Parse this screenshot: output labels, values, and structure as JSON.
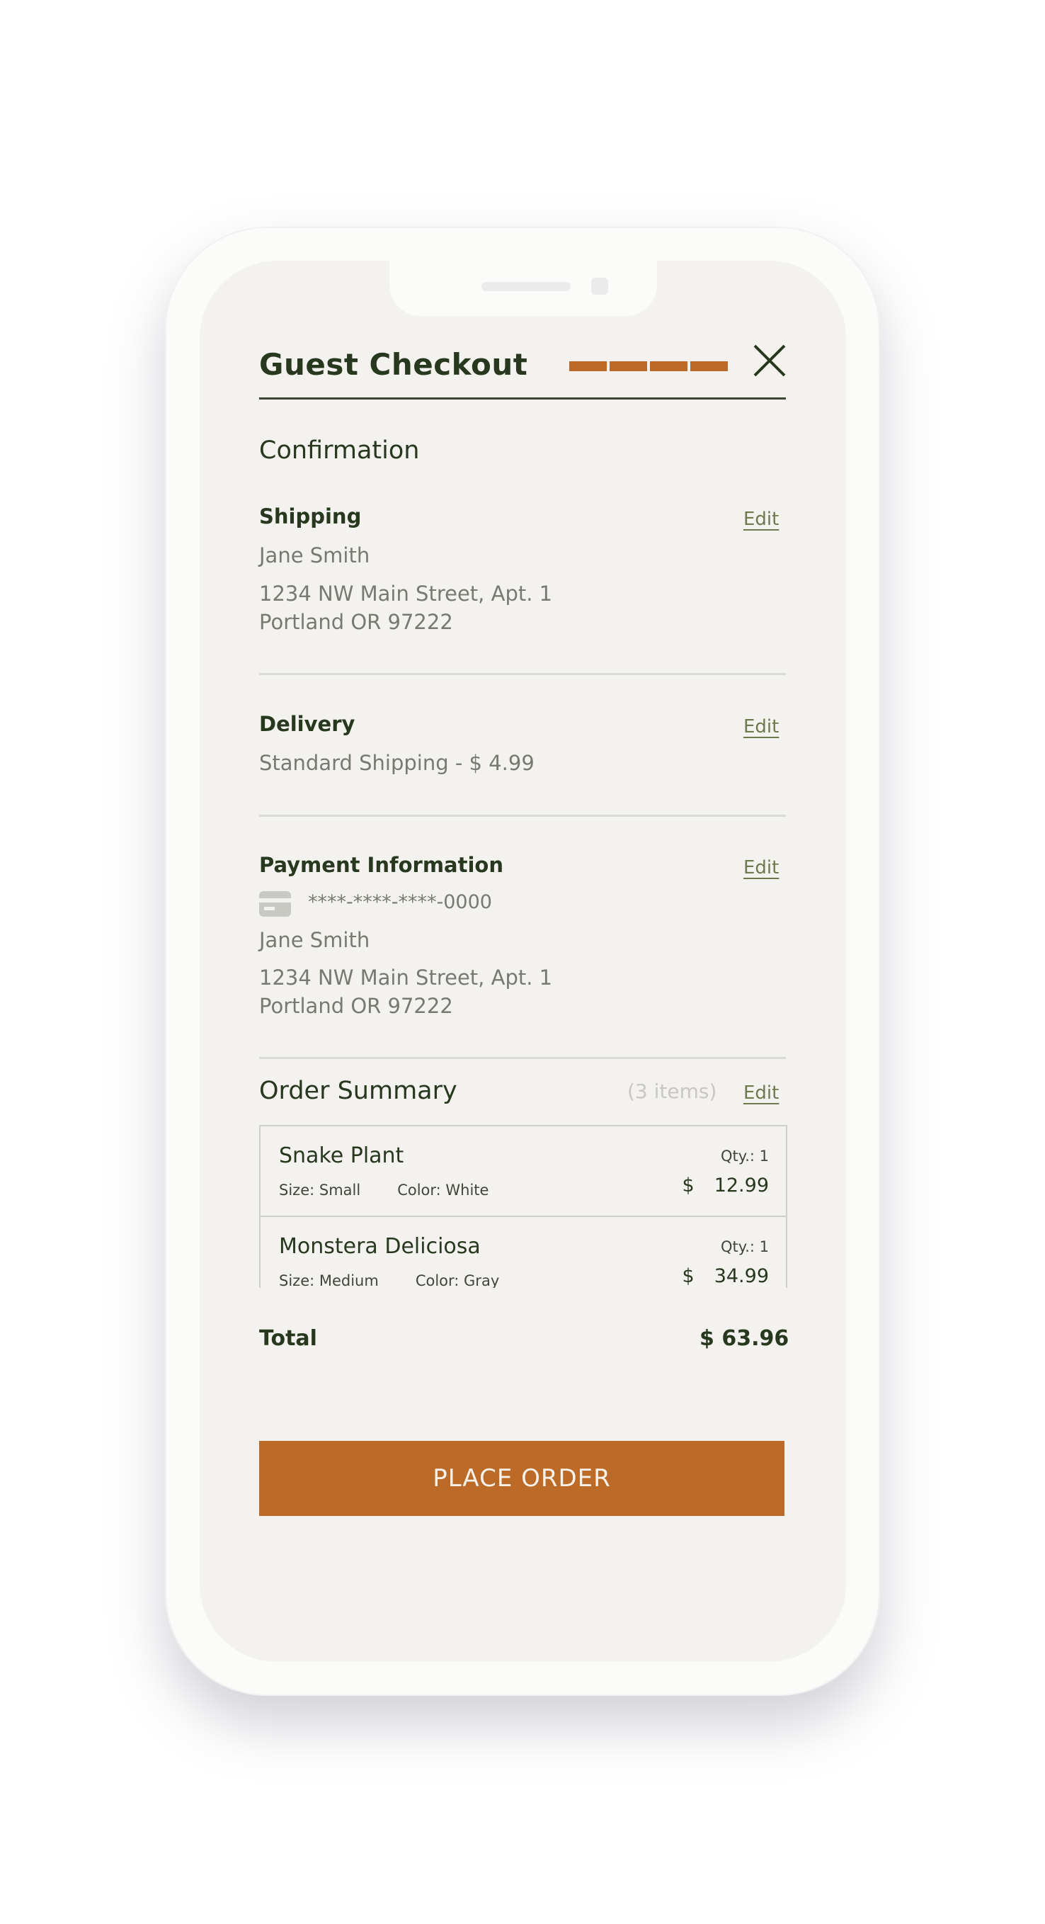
{
  "header": {
    "title": "Guest Checkout",
    "progress_steps": 4,
    "close_icon": "close-icon"
  },
  "step_title": "Confirmation",
  "shipping": {
    "heading": "Shipping",
    "edit_label": "Edit",
    "name": "Jane Smith",
    "address_line1": "1234 NW Main Street, Apt. 1",
    "address_line2": "Portland OR 97222"
  },
  "delivery": {
    "heading": "Delivery",
    "edit_label": "Edit",
    "method": "Standard Shipping - $ 4.99"
  },
  "payment": {
    "heading": "Payment Information",
    "edit_label": "Edit",
    "card_icon": "credit-card-icon",
    "card_number": "****-****-****-0000",
    "name": "Jane Smith",
    "address_line1": "1234 NW Main Street, Apt. 1",
    "address_line2": "Portland OR 97222"
  },
  "order_summary": {
    "heading": "Order Summary",
    "items_count": "(3 items)",
    "edit_label": "Edit",
    "items": [
      {
        "name": "Snake Plant",
        "size": "Size: Small",
        "color": "Color: White",
        "qty": "Qty.: 1",
        "currency": "$",
        "price": "12.99"
      },
      {
        "name": "Monstera Deliciosa",
        "size": "Size: Medium",
        "color": "Color: Gray",
        "qty": "Qty.: 1",
        "currency": "$",
        "price": "34.99"
      }
    ]
  },
  "total": {
    "label": "Total",
    "value": "$ 63.96"
  },
  "place_order_label": "PLACE ORDER",
  "colors": {
    "accent": "#bb6a27",
    "text_dark": "#27381f",
    "text_muted": "#767a70",
    "link": "#6e7a4e",
    "background": "#f3f2ef"
  }
}
